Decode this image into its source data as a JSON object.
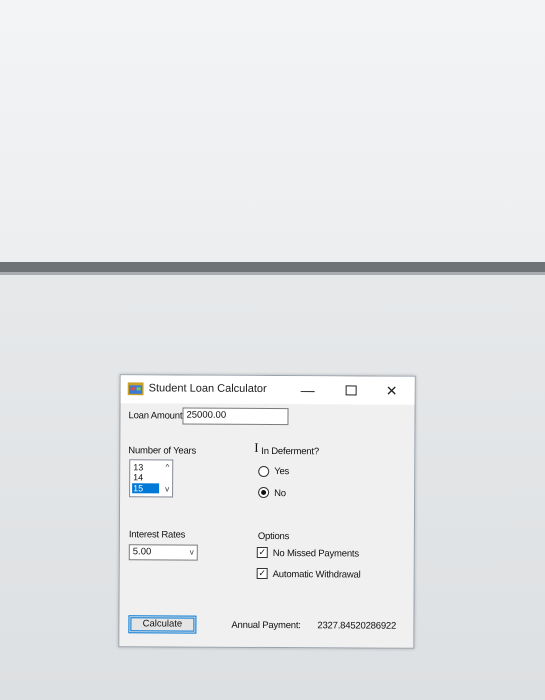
{
  "window": {
    "title": "Student Loan Calculator",
    "controls": {
      "minimize": "—",
      "close": "✕"
    }
  },
  "loan_amount": {
    "label": "Loan Amount",
    "value": "25000.00"
  },
  "years": {
    "label": "Number of Years",
    "items": [
      "13",
      "14",
      "15"
    ],
    "selected": "15"
  },
  "deferment": {
    "label": "In Deferment?",
    "options": [
      {
        "label": "Yes",
        "checked": false
      },
      {
        "label": "No",
        "checked": true
      }
    ]
  },
  "interest": {
    "label": "Interest Rates",
    "value": "5.00"
  },
  "options": {
    "label": "Options",
    "items": [
      {
        "label": "No Missed Payments",
        "checked": true
      },
      {
        "label": "Automatic Withdrawal",
        "checked": true
      }
    ]
  },
  "calculate_label": "Calculate",
  "payment": {
    "label": "Annual Payment:",
    "value": "2327.84520286922"
  },
  "colors": {
    "accent": "#0078d7",
    "window_bg": "#f0f0f0",
    "titlebar_bg": "#ffffff"
  },
  "icons": {
    "app": "app-window-icon",
    "list_up": "chevron-up-icon",
    "list_down": "chevron-down-icon",
    "combo": "chevron-down-icon",
    "cursor": "text-cursor-icon",
    "check": "checkmark-icon"
  }
}
